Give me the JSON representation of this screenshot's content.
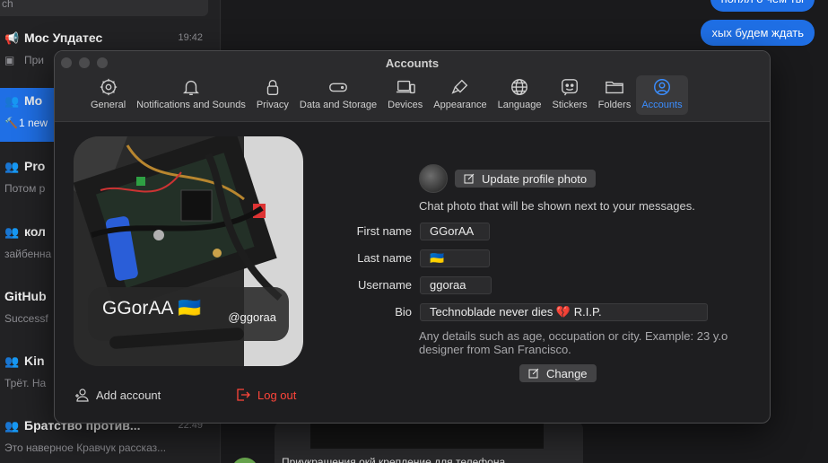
{
  "background": {
    "search_placeholder": "ch",
    "chats": [
      {
        "title": "Мос Упдатес",
        "subtitle": "При",
        "time": "19:42",
        "icon": "megaphone-icon"
      },
      {
        "title": "Мо",
        "subtitle": "1 new",
        "time": "",
        "icon": "group-icon"
      },
      {
        "title": "Pro",
        "subtitle": "Потом р",
        "time": "",
        "icon": "group-icon"
      },
      {
        "title": "кол",
        "subtitle": "зайбенна",
        "time": "",
        "icon": "group-icon"
      },
      {
        "title": "GitHub",
        "subtitle": "Successf",
        "time": "",
        "icon": ""
      },
      {
        "title": "Kin",
        "subtitle": "Трёт. На",
        "time": "",
        "icon": "group-icon"
      },
      {
        "title": "Братство против...",
        "subtitle": "Это наверное Кравчук рассказ...",
        "time": "22:49",
        "icon": "group-icon"
      }
    ],
    "bubbles": [
      "понял о чем ты",
      "хых будем ждать"
    ],
    "card_text": "Приукрашения окй крепление для телефона"
  },
  "window": {
    "title": "Accounts",
    "tabs": [
      {
        "label": "General",
        "icon": "gear-icon"
      },
      {
        "label": "Notifications and Sounds",
        "icon": "bell-icon"
      },
      {
        "label": "Privacy",
        "icon": "lock-icon"
      },
      {
        "label": "Data and Storage",
        "icon": "drive-icon"
      },
      {
        "label": "Devices",
        "icon": "devices-icon"
      },
      {
        "label": "Appearance",
        "icon": "brush-icon"
      },
      {
        "label": "Language",
        "icon": "globe-icon"
      },
      {
        "label": "Stickers",
        "icon": "sticker-icon"
      },
      {
        "label": "Folders",
        "icon": "folder-icon"
      },
      {
        "label": "Accounts",
        "icon": "account-icon"
      }
    ],
    "active_tab": "Accounts"
  },
  "profile": {
    "display_name": "GGorAA 🇺🇦",
    "username": "@ggoraa",
    "add_account": "Add account",
    "log_out": "Log out"
  },
  "form": {
    "update_photo": "Update profile photo",
    "photo_hint": "Chat photo that will be shown next to your messages.",
    "first_name_label": "First name",
    "first_name": "GGorAA",
    "last_name_label": "Last name",
    "last_name": "🇺🇦",
    "username_label": "Username",
    "username": "ggoraa",
    "bio_label": "Bio",
    "bio": "Technoblade never dies 💔 R.I.P.",
    "bio_help": "Any details such as age, occupation or city. Example: 23 y.o designer from San Francisco.",
    "change": "Change"
  },
  "colors": {
    "accent": "#3a8dff",
    "danger": "#ff453a",
    "selection": "#1f6fe5"
  }
}
